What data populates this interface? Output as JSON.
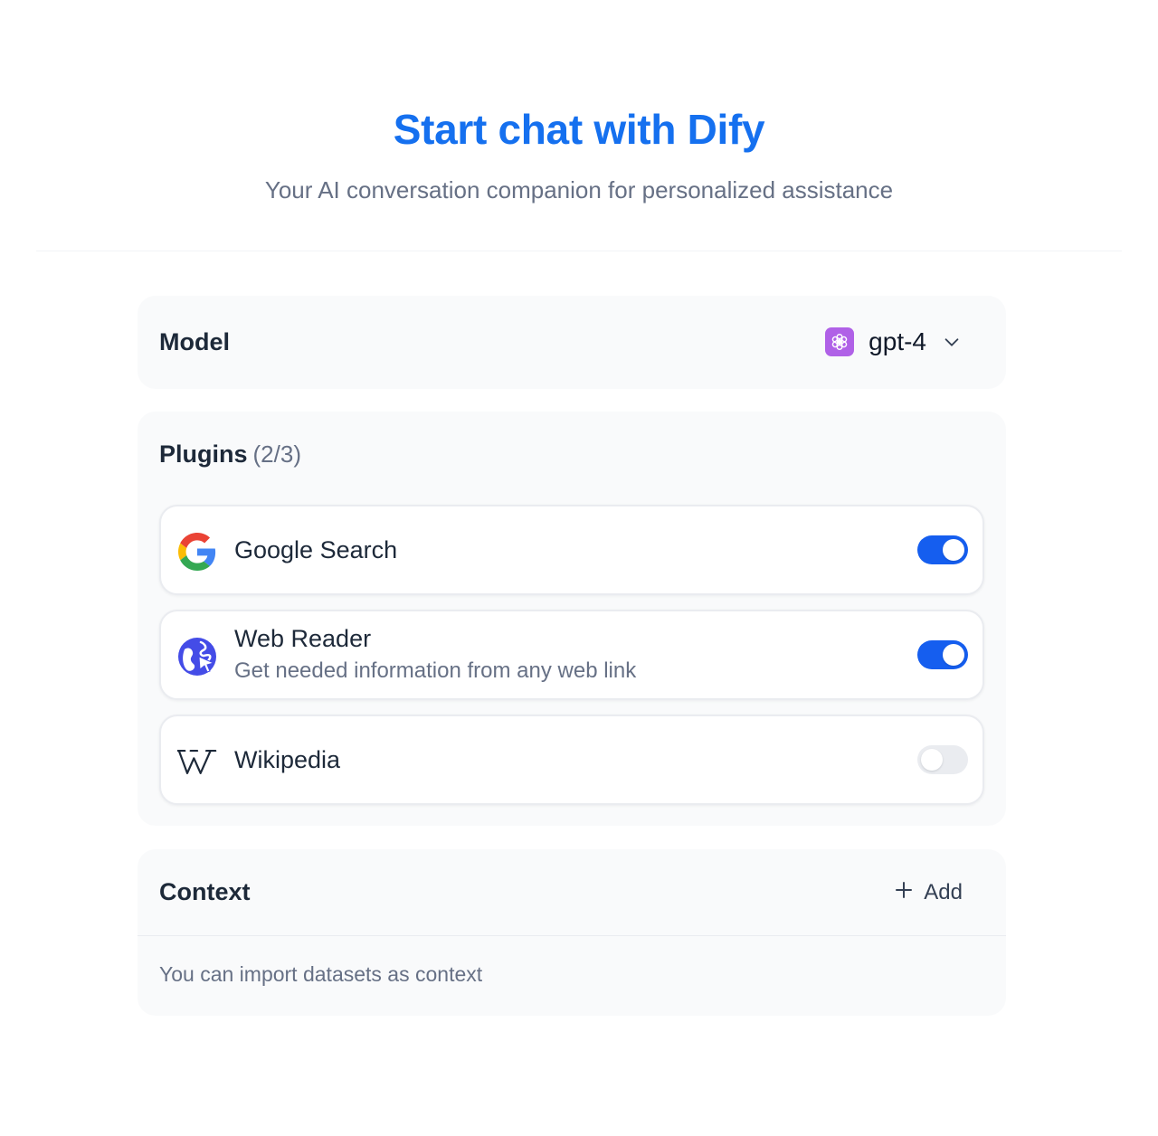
{
  "header": {
    "title": "Start chat with Dify",
    "subtitle": "Your AI conversation companion for personalized assistance"
  },
  "model": {
    "label": "Model",
    "selected": "gpt-4",
    "icon": "openai-icon",
    "chevron": "chevron-down-icon"
  },
  "plugins": {
    "title": "Plugins",
    "count": "(2/3)",
    "items": [
      {
        "name": "Google Search",
        "description": "",
        "icon": "google-icon",
        "enabled": true
      },
      {
        "name": "Web Reader",
        "description": "Get needed information from any web link",
        "icon": "web-reader-icon",
        "enabled": true
      },
      {
        "name": "Wikipedia",
        "description": "",
        "icon": "wikipedia-icon",
        "enabled": false
      }
    ]
  },
  "context": {
    "title": "Context",
    "add_label": "Add",
    "add_icon": "plus-icon",
    "hint": "You can import datasets as context"
  },
  "colors": {
    "accent": "#1570ef",
    "toggle_on": "#155eef",
    "toggle_off": "#eaecf0",
    "model_icon_bg": "#b061e7"
  }
}
